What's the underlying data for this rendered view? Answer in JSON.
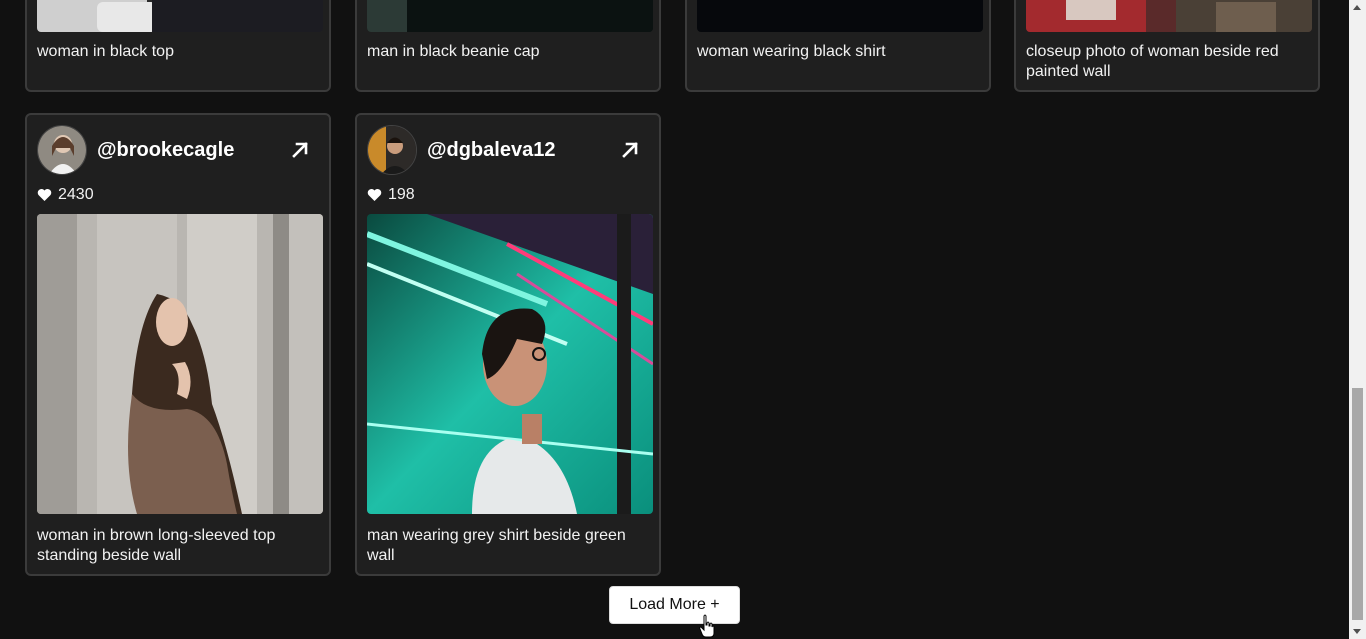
{
  "top_cards": [
    {
      "caption": "woman in black top"
    },
    {
      "caption": "man in black beanie cap"
    },
    {
      "caption": "woman wearing black shirt"
    },
    {
      "caption": "closeup photo of woman beside red painted wall"
    }
  ],
  "cards": [
    {
      "username": "@brookecagle",
      "likes": "2430",
      "caption": "woman in brown long-sleeved top standing beside wall"
    },
    {
      "username": "@dgbaleva12",
      "likes": "198",
      "caption": "man wearing grey shirt beside green wall"
    }
  ],
  "load_more_label": "Load More +",
  "icons": {
    "open": "arrow-up-right-icon",
    "like": "heart-icon"
  },
  "colors": {
    "background": "#111111",
    "card": "#1f1f1f",
    "card_border": "#3b3b3b",
    "button_bg": "#ffffff"
  }
}
